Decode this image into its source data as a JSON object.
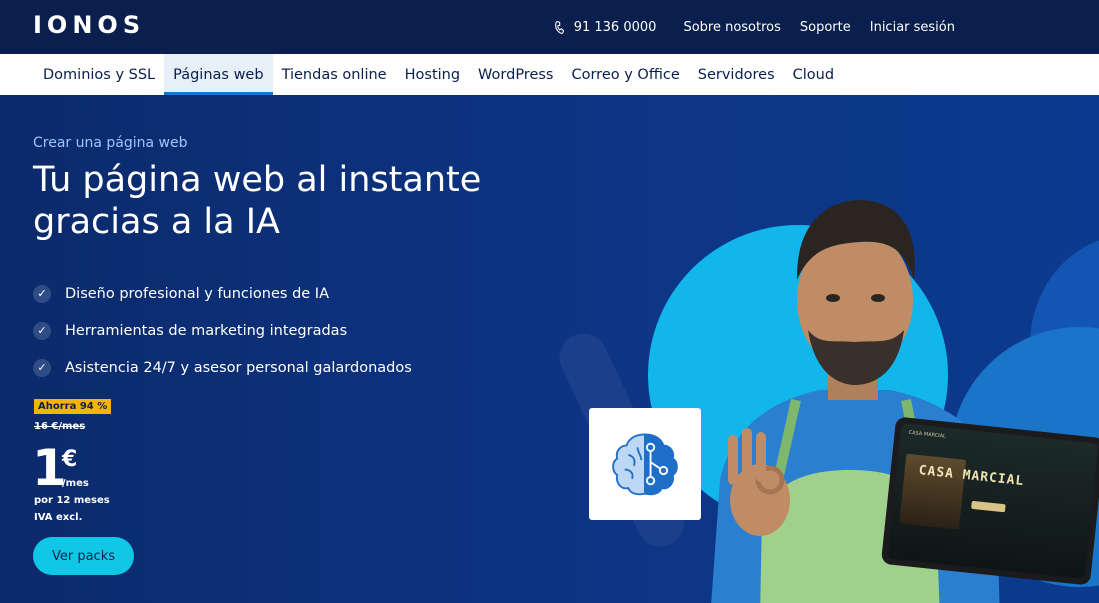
{
  "brand": {
    "logo": "IONOS"
  },
  "top_links": {
    "phone": "91 136 0000",
    "about": "Sobre nosotros",
    "support": "Soporte",
    "login": "Iniciar sesión"
  },
  "nav": {
    "items": [
      {
        "label": "Dominios y SSL"
      },
      {
        "label": "Páginas web",
        "active": true
      },
      {
        "label": "Tiendas online"
      },
      {
        "label": "Hosting"
      },
      {
        "label": "WordPress"
      },
      {
        "label": "Correo y Office"
      },
      {
        "label": "Servidores"
      },
      {
        "label": "Cloud"
      }
    ]
  },
  "hero": {
    "eyebrow": "Crear una página web",
    "headline": "Tu página web al instante gracias a la IA",
    "features": [
      "Diseño profesional y funciones de IA",
      "Herramientas de marketing integradas",
      "Asistencia 24/7 y asesor personal galardonados"
    ],
    "badge": "Ahorra 94 %",
    "old_price": "16 €/mes",
    "price": "1",
    "currency": "€",
    "per": "/mes",
    "term": "por 12 meses",
    "tax": "IVA excl.",
    "cta": "Ver packs"
  },
  "tablet": {
    "small_label": "CASA MARCIAL",
    "title": "CASA MARCIAL"
  },
  "colors": {
    "topbar_bg": "#0a1f4d",
    "hero_bg": "#0b2a6b",
    "accent_cyan": "#11c7e6",
    "badge_yellow": "#f5b400",
    "nav_active_border": "#1a74c8"
  },
  "icons": {
    "phone": "phone-icon",
    "check": "check-icon",
    "ai_brain": "ai-brain-icon"
  }
}
